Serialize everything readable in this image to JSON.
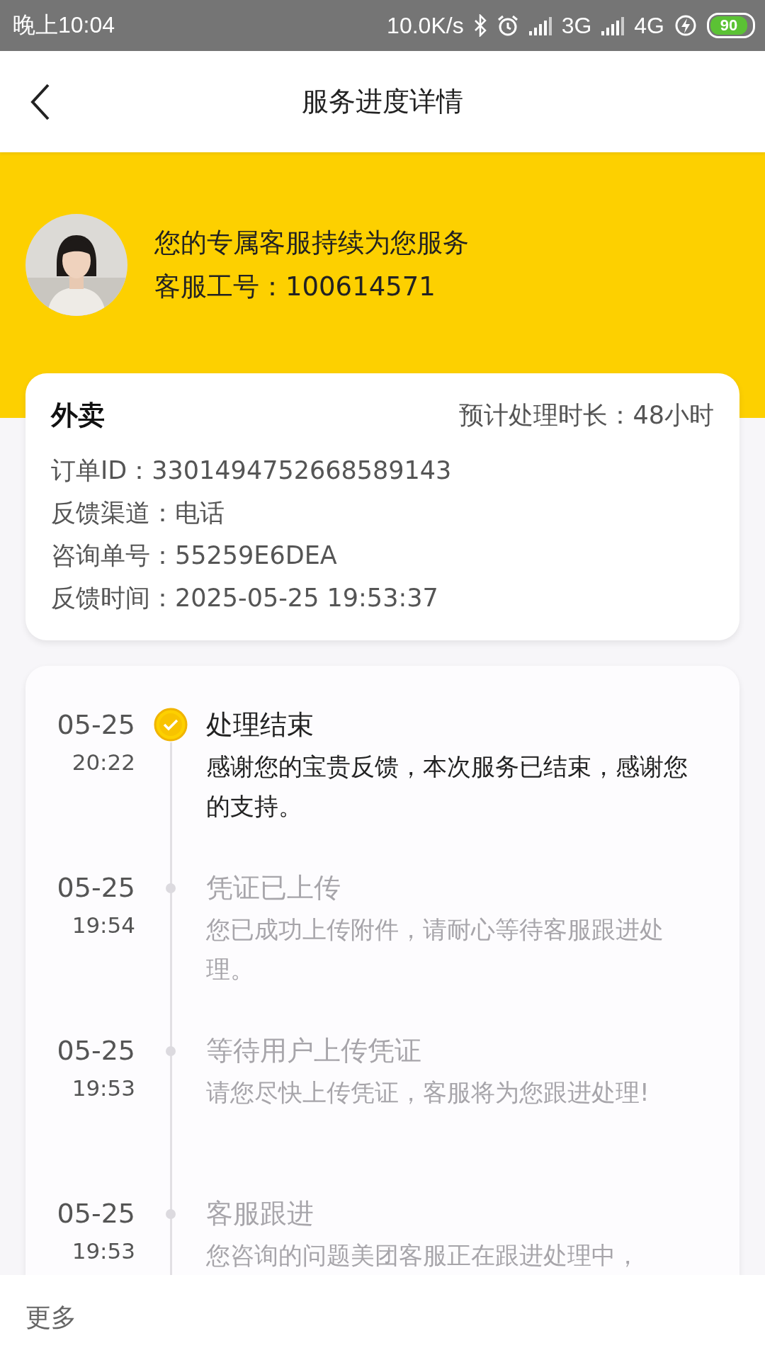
{
  "status_bar": {
    "time": "晚上10:04",
    "speed": "10.0K/s",
    "network_1": "3G",
    "network_2": "4G",
    "battery": "90"
  },
  "header": {
    "title": "服务进度详情"
  },
  "agent": {
    "line_1": "您的专属客服持续为您服务",
    "line_2": "客服工号：100614571"
  },
  "order": {
    "category": "外卖",
    "estimate": "预计处理时长：48小时",
    "fields": [
      "订单ID：3301494752668589143",
      "反馈渠道：电话",
      "咨询单号：55259E6DEA",
      "反馈时间：2025-05-25 19:53:37"
    ]
  },
  "timeline": [
    {
      "date": "05-25",
      "time": "20:22",
      "title": "处理结束",
      "description": "感谢您的宝贵反馈，本次服务已结束，感谢您的支持。",
      "done": true
    },
    {
      "date": "05-25",
      "time": "19:54",
      "title": "凭证已上传",
      "description": "您已成功上传附件，请耐心等待客服跟进处理。",
      "done": false
    },
    {
      "date": "05-25",
      "time": "19:53",
      "title": "等待用户上传凭证",
      "description": "请您尽快上传凭证，客服将为您跟进处理!",
      "done": false
    },
    {
      "date": "05-25",
      "time": "19:53",
      "title": "客服跟进",
      "description": "您咨询的问题美团客服正在跟进处理中，",
      "done": false
    }
  ],
  "footer": {
    "more": "更多"
  }
}
